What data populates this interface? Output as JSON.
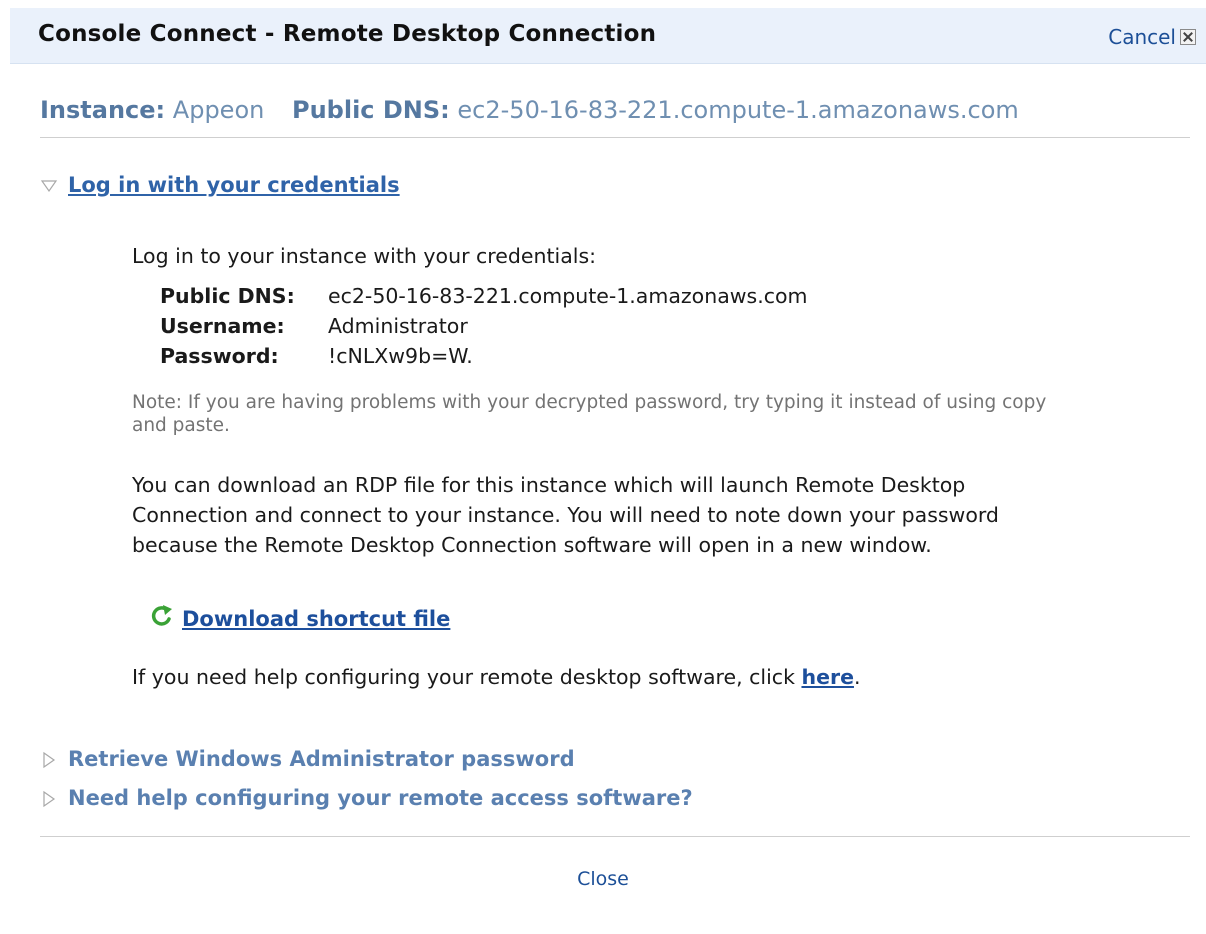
{
  "dialog": {
    "title": "Console Connect - Remote Desktop Connection",
    "cancel_label": "Cancel"
  },
  "instance": {
    "instance_label": "Instance:",
    "instance_value": "Appeon",
    "dns_label": "Public DNS:",
    "dns_value": "ec2-50-16-83-221.compute-1.amazonaws.com"
  },
  "sections": {
    "login": {
      "title": "Log in with your credentials",
      "expanded": true,
      "intro": "Log in to your instance with your credentials:",
      "credentials": [
        {
          "label": "Public DNS:",
          "value": "ec2-50-16-83-221.compute-1.amazonaws.com"
        },
        {
          "label": "Username:",
          "value": "Administrator"
        },
        {
          "label": "Password:",
          "value": "!cNLXw9b=W."
        }
      ],
      "note": "Note: If you are having problems with your decrypted password, try typing it instead of using copy and paste.",
      "rdp_paragraph": "You can download an RDP file for this instance which will launch Remote Desktop Connection and connect to your instance. You will need to note down your password because the Remote Desktop Connection software will open in a new window.",
      "download_label": "Download shortcut file",
      "help_prefix": "If you need help configuring your remote desktop software, click ",
      "help_link": "here",
      "help_suffix": "."
    },
    "retrieve_password": {
      "title": "Retrieve Windows Administrator password",
      "expanded": false
    },
    "remote_access_help": {
      "title": "Need help configuring your remote access software?",
      "expanded": false
    }
  },
  "footer": {
    "close_label": "Close"
  },
  "colors": {
    "header_bg": "#eaf1fb",
    "link": "#1d4f9c",
    "section_link": "#2f63a8",
    "muted_text": "#737373"
  }
}
